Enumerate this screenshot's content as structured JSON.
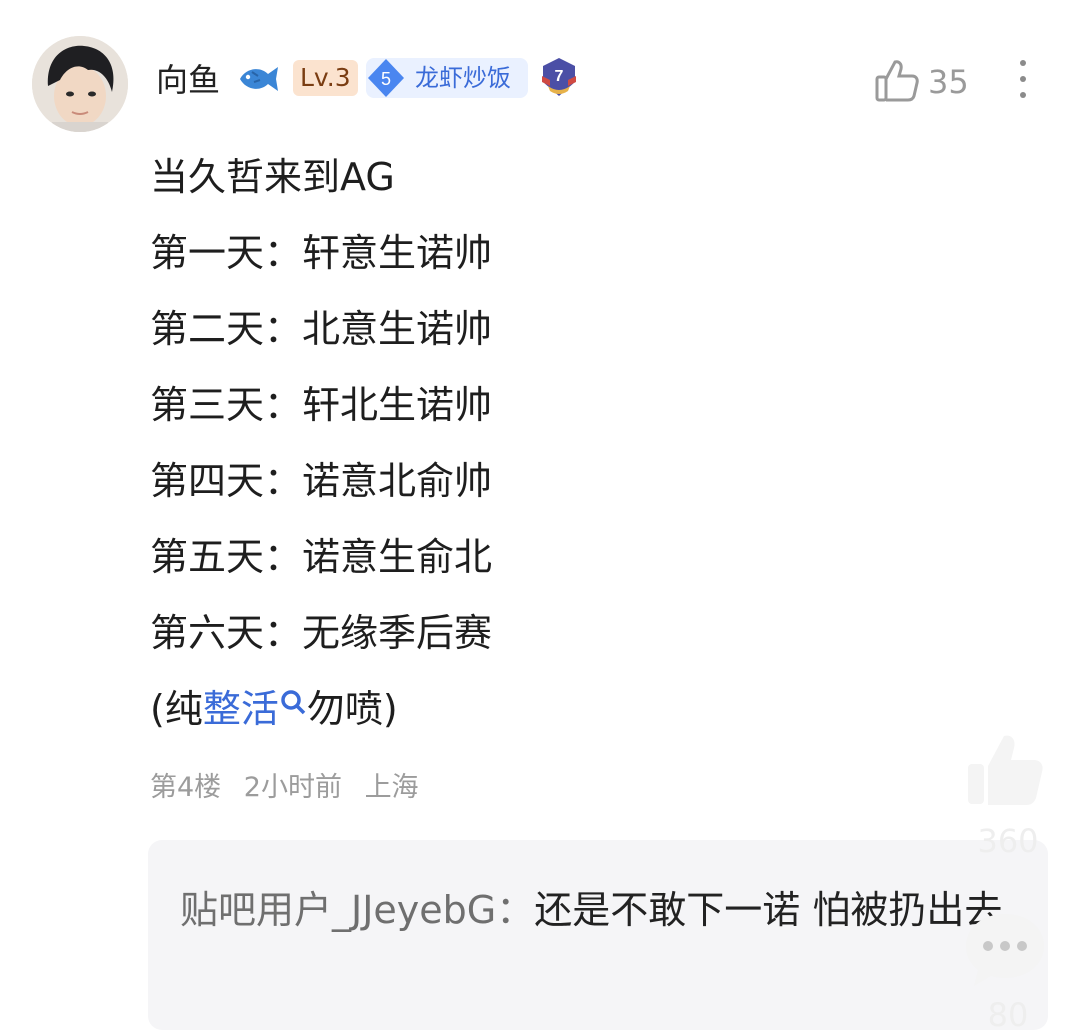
{
  "comment": {
    "username": "向鱼",
    "level": "Lv.3",
    "tag_number": "5",
    "tag_label": "龙虾炒饭",
    "rank_number": "7",
    "like_count": "35",
    "lines": [
      "当久哲来到AG",
      "第一天：轩意生诺帅",
      "第二天：北意生诺帅",
      "第三天：轩北生诺帅",
      "第四天：诺意北俞帅",
      "第五天：诺意生俞北",
      "第六天：无缘季后赛"
    ],
    "last_line": {
      "open": "(纯",
      "link": "整活",
      "close": "勿喷)"
    },
    "floor": "第4楼",
    "time": "2小时前",
    "location": "上海"
  },
  "reply": {
    "user": "贴吧用户_JJeyebG",
    "separator": "：",
    "text": "还是不敢下一诺 怕被扔出去"
  },
  "side_actions": {
    "like_count": "360",
    "comment_count": "80"
  },
  "colors": {
    "link": "#3a6bd8",
    "level_bg": "#fbe3cf",
    "tag_bg": "#eaf1ff"
  }
}
